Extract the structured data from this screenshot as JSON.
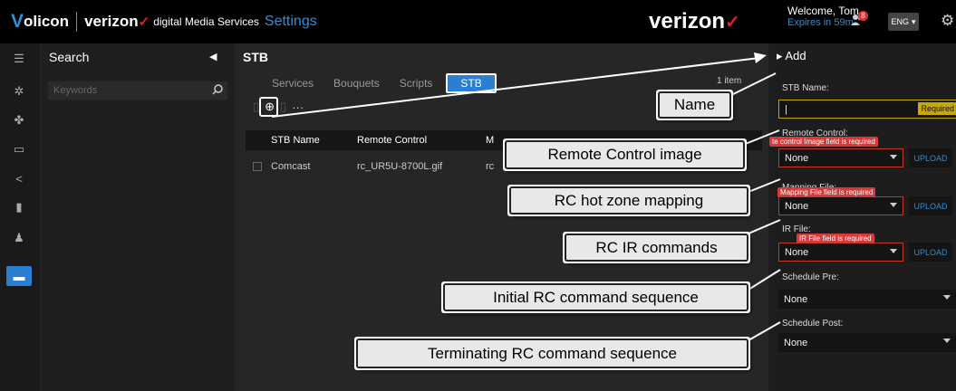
{
  "header": {
    "brand_v": "V",
    "brand_rest": "olicon",
    "verizon_small": "verizon",
    "check": "✓",
    "dms": "digital Media Services",
    "section": "Settings",
    "verizon_big": "verizon",
    "welcome": "Welcome, Tom",
    "expires": "Expires in 59m",
    "notification_count": "8",
    "language": "ENG"
  },
  "leftnav": {
    "items": [
      "menu-icon",
      "dashboard-icon",
      "puzzle-icon",
      "monitor-icon",
      "share-icon",
      "clipboard-icon",
      "user-icon",
      "stb-icon"
    ]
  },
  "search": {
    "title": "Search",
    "placeholder": "Keywords"
  },
  "main": {
    "title": "STB",
    "tabs": [
      "Services",
      "Bouquets",
      "Scripts",
      "STB"
    ],
    "active_tab": "STB",
    "item_count": "1 item",
    "toolbar_more": "···",
    "columns": [
      "STB Name",
      "Remote Control",
      "M"
    ],
    "rows": [
      {
        "name": "Comcast",
        "remote": "rc_UR5U-8700L.gif",
        "m": "rc"
      }
    ]
  },
  "panel": {
    "title": "Add",
    "stb_name_label": "STB Name:",
    "stb_name_value": "|",
    "required": "Required",
    "remote_label": "Remote Control:",
    "remote_error": "te control Image field is required",
    "remote_value": "None",
    "mapping_label": "Mapping File:",
    "mapping_error": "Mapping File field is required",
    "mapping_value": "None",
    "ir_label": "IR File:",
    "ir_error": "IR File field is required",
    "ir_value": "None",
    "schedule_pre_label": "Schedule Pre:",
    "schedule_pre_value": "None",
    "schedule_post_label": "Schedule Post:",
    "schedule_post_value": "None",
    "upload": "UPLOAD"
  },
  "callouts": {
    "name": "Name",
    "remote": "Remote Control image",
    "hotzone": "RC hot zone mapping",
    "ir": "RC IR commands",
    "initial": "Initial RC command sequence",
    "terminating": "Terminating RC command sequence"
  }
}
